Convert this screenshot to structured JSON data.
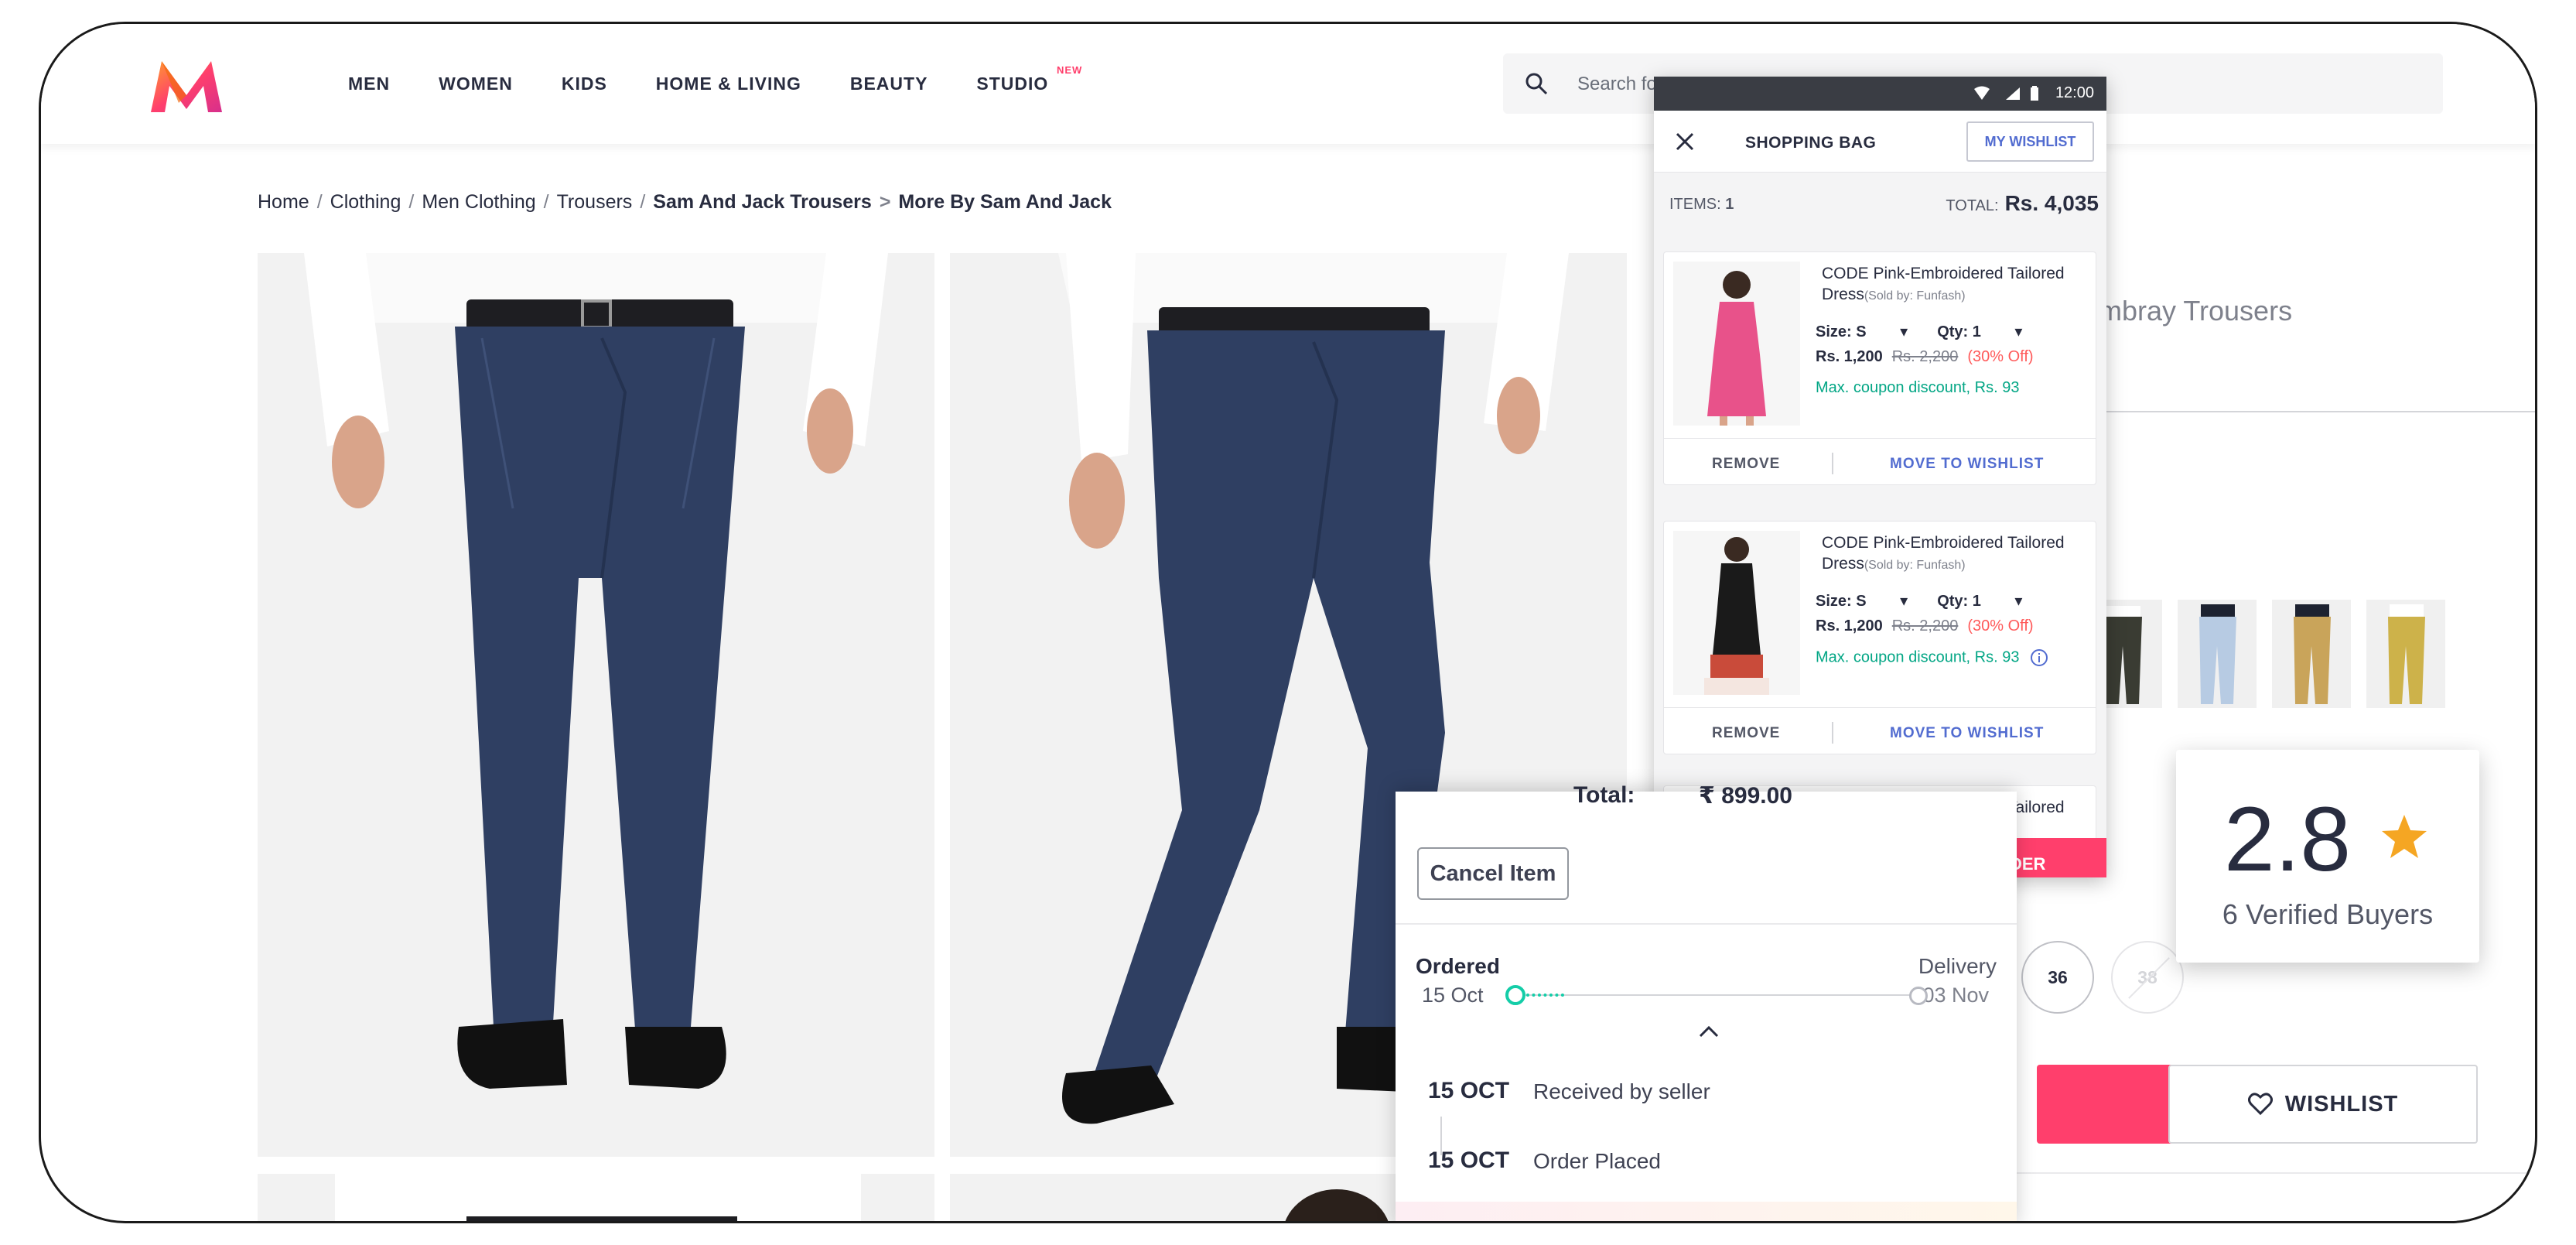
{
  "header": {
    "nav": [
      "MEN",
      "WOMEN",
      "KIDS",
      "HOME & LIVING",
      "BEAUTY",
      "STUDIO"
    ],
    "studio_badge": "NEW",
    "search_placeholder": "Search fo"
  },
  "breadcrumb": {
    "items": [
      "Home",
      "Clothing",
      "Men Clothing",
      "Trousers"
    ],
    "brand": "Sam And Jack Trousers",
    "more_sep": ">",
    "more": "More By Sam And Jack"
  },
  "product": {
    "title_fragment": "mbray Trousers",
    "sizes": [
      "36",
      "38"
    ],
    "wishlist_label": "WISHLIST",
    "rating": {
      "value": "2.8",
      "buyers": "6 Verified Buyers"
    }
  },
  "bag": {
    "status_time": "12:00",
    "title": "SHOPPING BAG",
    "my_wishlist": "MY WISHLIST",
    "items_label": "ITEMS:",
    "items_count": "1",
    "total_label": "TOTAL:",
    "total_value": "Rs. 4,035",
    "cards": [
      {
        "name": "CODE Pink-Embroidered Tailored Dress",
        "seller": "(Sold by: Funfash)",
        "size": "Size: S",
        "qty": "Qty: 1",
        "price": "Rs. 1,200",
        "mrp": "Rs. 2,200",
        "discount": "(30% Off)",
        "coupon": "Max. coupon discount, Rs. 93",
        "remove": "REMOVE",
        "move": "MOVE TO WISHLIST"
      },
      {
        "name": "CODE Pink-Embroidered Tailored Dress",
        "seller": "(Sold by: Funfash)",
        "size": "Size: S",
        "qty": "Qty: 1",
        "price": "Rs. 1,200",
        "mrp": "Rs. 2,200",
        "discount": "(30% Off)",
        "coupon": "Max. coupon discount, Rs. 93",
        "remove": "REMOVE",
        "move": "MOVE TO WISHLIST"
      },
      {
        "name": "CODE Pink-Embroidered Tailored"
      }
    ],
    "place_order_fragment": "DER"
  },
  "tracking": {
    "total_label": "Total:",
    "total_value": "₹ 899.00",
    "cancel_label": "Cancel Item",
    "ordered_label": "Ordered",
    "ordered_date": "15 Oct",
    "delivery_label": "Delivery",
    "delivery_date": "03 Nov",
    "events": [
      {
        "date": "15 OCT",
        "text": "Received by seller"
      },
      {
        "date": "15 OCT",
        "text": "Order Placed"
      }
    ]
  },
  "colors": {
    "brand_pink": "#ff3f6c",
    "accent_blue": "#526cd0",
    "teal": "#14cda8",
    "star": "#f5a623"
  }
}
